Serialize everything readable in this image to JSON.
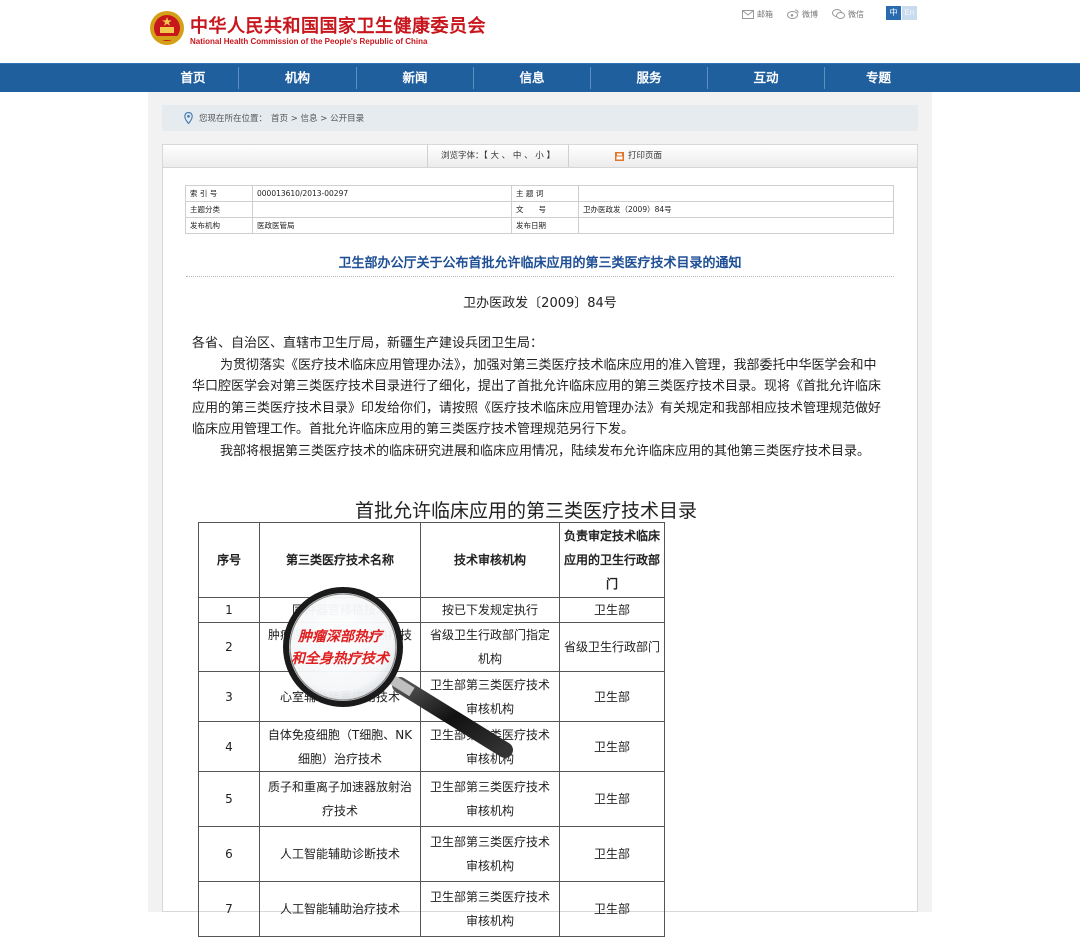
{
  "header": {
    "title_cn": "中华人民共和国国家卫生健康委员会",
    "title_en": "National Health Commission of the People's Republic of China",
    "links": [
      {
        "icon": "mail-icon",
        "label": "邮箱"
      },
      {
        "icon": "weibo-icon",
        "label": "微博"
      },
      {
        "icon": "wechat-icon",
        "label": "微信"
      }
    ],
    "lang_zh": "中",
    "lang_en": "En"
  },
  "nav": {
    "items": [
      "首页",
      "机构",
      "新闻",
      "信息",
      "服务",
      "互动",
      "专题"
    ]
  },
  "breadcrumb": {
    "prefix": "您现在所在位置：",
    "path": "首页 > 信息 > 公开目录"
  },
  "toolbar": {
    "font_size": "浏览字体：【 大 、 中 、 小 】",
    "print": "打印页面"
  },
  "meta": {
    "rows": [
      [
        "索 引 号",
        "000013610/2013-00297",
        "主 题 词",
        ""
      ],
      [
        "主题分类",
        "",
        "文　　号",
        "卫办医政发（2009）84号"
      ],
      [
        "发布机构",
        "医政医管局",
        "发布日期",
        ""
      ]
    ]
  },
  "document": {
    "title": "卫生部办公厅关于公布首批允许临床应用的第三类医疗技术目录的通知",
    "number": "卫办医政发〔2009〕84号",
    "salutation": "各省、自治区、直辖市卫生厅局，新疆生产建设兵团卫生局：",
    "para1": "为贯彻落实《医疗技术临床应用管理办法》，加强对第三类医疗技术临床应用的准入管理，我部委托中华医学会和中华口腔医学会对第三类医疗技术目录进行了细化，提出了首批允许临床应用的第三类医疗技术目录。现将《首批允许临床应用的第三类医疗技术目录》印发给你们，请按照《医疗技术临床应用管理办法》有关规定和我部相应技术管理规范做好临床应用管理工作。首批允许临床应用的第三类医疗技术管理规范另行下发。",
    "para2": "我部将根据第三类医疗技术的临床研究进展和临床应用情况，陆续发布允许临床应用的其他第三类医疗技术目录。"
  },
  "tech_table": {
    "title": "首批允许临床应用的第三类医疗技术目录",
    "headers": [
      "序号",
      "第三类医疗技术名称",
      "技术审核机构",
      "负责审定技术临床应用的卫生行政部门"
    ],
    "rows": [
      [
        "1",
        "同种器官移植技术",
        "按已下发规定执行",
        "卫生部"
      ],
      [
        "2",
        "肿瘤深部热疗和全身热疗技术",
        "省级卫生行政部门指定机构",
        "省级卫生行政部门"
      ],
      [
        "3",
        "心室辅助装置应用技术",
        "卫生部第三类医疗技术审核机构",
        "卫生部"
      ],
      [
        "4",
        "自体免疫细胞（T细胞、NK细胞）治疗技术",
        "卫生部第三类医疗技术审核机构",
        "卫生部"
      ],
      [
        "5",
        "质子和重离子加速器放射治疗技术",
        "卫生部第三类医疗技术审核机构",
        "卫生部"
      ],
      [
        "6",
        "人工智能辅助诊断技术",
        "卫生部第三类医疗技术审核机构",
        "卫生部"
      ],
      [
        "7",
        "人工智能辅助治疗技术",
        "卫生部第三类医疗技术审核机构",
        "卫生部"
      ]
    ]
  },
  "magnifier": {
    "icon": "magnifier-icon",
    "lens_line1": "肿瘤深部热疗",
    "lens_line2": "和全身热疗技术"
  },
  "colors": {
    "brand_red": "#c8161d",
    "nav_blue": "#1f5f9e",
    "title_blue": "#1e4f95",
    "highlight_red": "#e02020"
  }
}
